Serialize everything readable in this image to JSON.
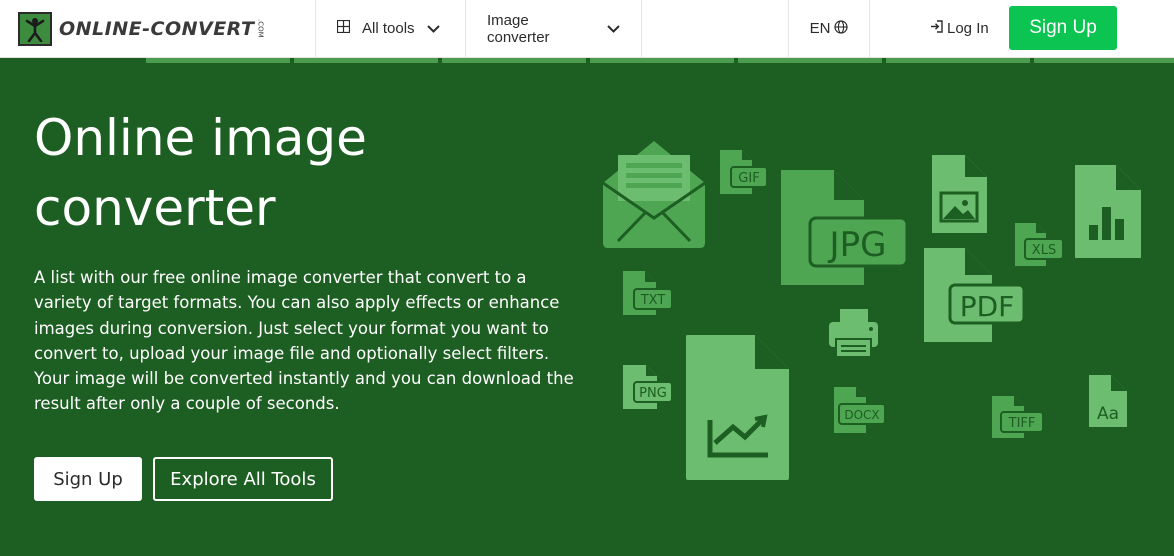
{
  "header": {
    "logo_text": "ONLINE-CONVERT",
    "logo_tld": ".COM",
    "all_tools": "All tools",
    "image_converter": "Image converter",
    "language": "EN",
    "login": "Log In",
    "signup": "Sign Up"
  },
  "hero": {
    "title_line1": "Online image",
    "title_line2": "converter",
    "description": "A list with our free online image converter that convert to a variety of target formats. You can also apply effects or enhance images during conversion. Just select your format you want to convert to, upload your image file and optionally select filters. Your image will be converted instantly and you can download the result after only a couple of seconds.",
    "signup_button": "Sign Up",
    "explore_button": "Explore All Tools"
  },
  "illustration": {
    "labels": {
      "gif": "GIF",
      "jpg": "JPG",
      "xls": "XLS",
      "txt": "TXT",
      "pdf": "PDF",
      "png": "PNG",
      "docx": "DOCX",
      "tiff": "TIFF",
      "font": "Aa"
    }
  },
  "colors": {
    "hero_bg": "#1d5e22",
    "accent": "#0bc452",
    "icon_light": "#6cbd6f",
    "icon_mid": "#4ea552"
  }
}
